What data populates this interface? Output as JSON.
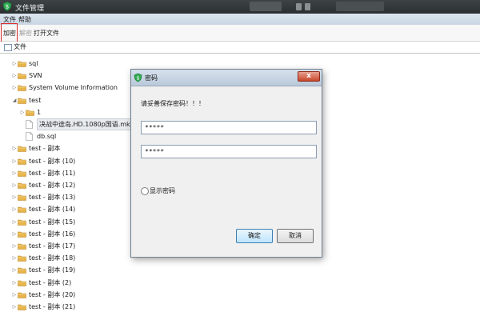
{
  "window": {
    "title": "文件管理"
  },
  "menu": {
    "file": "文件",
    "help": "帮助"
  },
  "toolbar": {
    "encrypt": "加密",
    "decrypt": "解密",
    "open_file": "打开文件"
  },
  "tab": {
    "label": "文件"
  },
  "tree": {
    "items": [
      {
        "label": "sql",
        "type": "folder",
        "indent": 0,
        "expanded": false
      },
      {
        "label": "SVN",
        "type": "folder",
        "indent": 0,
        "expanded": false
      },
      {
        "label": "System Volume Information",
        "type": "folder",
        "indent": 0,
        "expanded": false
      },
      {
        "label": "test",
        "type": "folder",
        "indent": 0,
        "expanded": true
      },
      {
        "label": "1",
        "type": "folder",
        "indent": 1,
        "expanded": false
      },
      {
        "label": "决战中途岛.HD.1080p国语.mkv",
        "type": "file",
        "indent": 1,
        "selected": true
      },
      {
        "label": "db.sql",
        "type": "file",
        "indent": 1
      },
      {
        "label": "test - 副本",
        "type": "folder",
        "indent": 0,
        "expanded": false
      },
      {
        "label": "test - 副本 (10)",
        "type": "folder",
        "indent": 0,
        "expanded": false
      },
      {
        "label": "test - 副本 (11)",
        "type": "folder",
        "indent": 0,
        "expanded": false
      },
      {
        "label": "test - 副本 (12)",
        "type": "folder",
        "indent": 0,
        "expanded": false
      },
      {
        "label": "test - 副本 (13)",
        "type": "folder",
        "indent": 0,
        "expanded": false
      },
      {
        "label": "test - 副本 (14)",
        "type": "folder",
        "indent": 0,
        "expanded": false
      },
      {
        "label": "test - 副本 (15)",
        "type": "folder",
        "indent": 0,
        "expanded": false
      },
      {
        "label": "test - 副本 (16)",
        "type": "folder",
        "indent": 0,
        "expanded": false
      },
      {
        "label": "test - 副本 (17)",
        "type": "folder",
        "indent": 0,
        "expanded": false
      },
      {
        "label": "test - 副本 (18)",
        "type": "folder",
        "indent": 0,
        "expanded": false
      },
      {
        "label": "test - 副本 (19)",
        "type": "folder",
        "indent": 0,
        "expanded": false
      },
      {
        "label": "test - 副本 (2)",
        "type": "folder",
        "indent": 0,
        "expanded": false
      },
      {
        "label": "test - 副本 (20)",
        "type": "folder",
        "indent": 0,
        "expanded": false
      },
      {
        "label": "test - 副本 (21)",
        "type": "folder",
        "indent": 0,
        "expanded": false
      }
    ]
  },
  "dialog": {
    "title": "密码",
    "close_label": "x",
    "prompt": "请妥善保存密码！！！",
    "password_value": "*****",
    "confirm_value": "*****",
    "show_password_label": "显示密码",
    "ok_label": "确定",
    "cancel_label": "取消"
  },
  "colors": {
    "folder": "#e8b54a",
    "accent_red": "#e02b2b",
    "app_icon": "#2faa52"
  }
}
